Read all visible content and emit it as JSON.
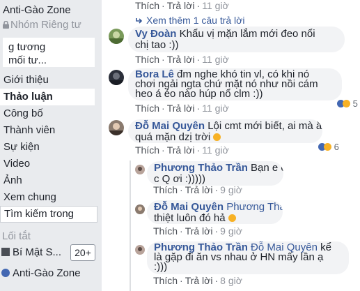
{
  "sidebar": {
    "group_title": "Anti-Gào Zone",
    "group_type": "Nhóm Riêng tư",
    "cover_lines": [
      "g tương",
      "mối tư..."
    ],
    "nav": [
      "Giới thiệu",
      "Thảo luận",
      "Công bố",
      "Thành viên",
      "Sự kiện",
      "Video",
      "Ảnh",
      "Xem chung"
    ],
    "active_nav": "Thảo luận",
    "search_placeholder": "Tìm kiếm trong",
    "shortcuts_header": "Lối tắt",
    "shortcuts": [
      {
        "label": "Bí Mật S...",
        "badge": "20+"
      },
      {
        "label": "Anti-Gào Zone"
      }
    ]
  },
  "thread": {
    "top_actions": {
      "like": "Thích",
      "reply": "Trả lời",
      "time": "11 giờ"
    },
    "more_replies": "Xem thêm 1 câu trả lời",
    "comments": [
      {
        "name": "Vy Đoàn",
        "text_l1": "Khẩu vị mặn lắm mới đeo nổi",
        "text_l2": "chị tao :))",
        "like": "Thích",
        "reply": "Trả lời",
        "time": "11 giờ"
      },
      {
        "name": "Bora Lê",
        "text_l1": "đm nghe khó tin vl, có khi nó",
        "text_l2": "chơi ngải ngta chứ mặt nó như nồi cám",
        "text_l3": "heo á éo nào húp nổ clm :))",
        "like": "Thích",
        "reply": "Trả lời",
        "time": "11 giờ",
        "reactions": "5"
      },
      {
        "name": "Đỗ Mai Quyên",
        "text_l1": "Lội cmt mới biết, ai mà ăn",
        "text_l2": "quá mặn dzị trời",
        "like": "Thích",
        "reply": "Trả lời",
        "time": "11 giờ",
        "reactions": "6"
      }
    ],
    "replies": [
      {
        "name": "Phương Thảo Trần",
        "text_l1": "Bạn e cx kể y hệt",
        "text_l2": "c Q ơi :)))))",
        "like": "Thích",
        "reply": "Trả lời",
        "time": "9 giờ"
      },
      {
        "name": "Đỗ Mai Quyên",
        "tag": "Phương Thảo Trần",
        "text_l2": "thiệt luôn đó hả",
        "like": "Thích",
        "reply": "Trả lời",
        "time": "9 giờ"
      },
      {
        "name": "Phương Thảo Trần",
        "tag": "Đỗ Mai Quyên",
        "text_l1": "kể",
        "text_l2": "là gặp đi ăn vs nhau ở HN mấy lần ạ",
        "text_l3": ":)))",
        "like": "Thích",
        "reply": "Trả lời",
        "time": "8 giờ"
      }
    ]
  },
  "colors": {
    "link": "#365899",
    "sidebar_bg": "#e9ebee",
    "bubble": "#f2f3f5"
  }
}
